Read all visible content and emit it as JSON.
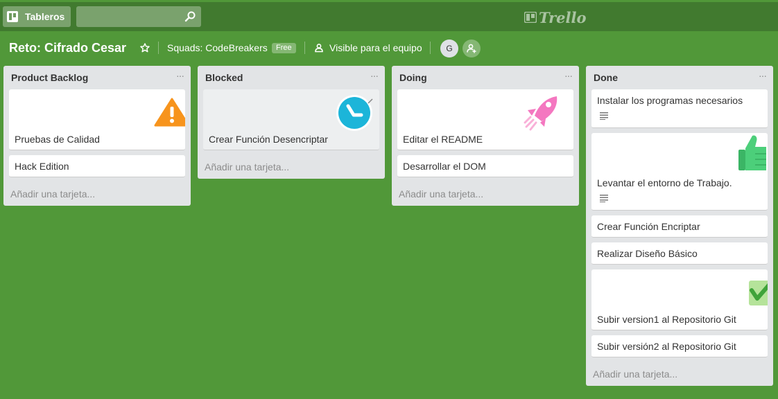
{
  "header": {
    "boards_label": "Tableros",
    "search_placeholder": "",
    "logo_text": "Trello"
  },
  "board": {
    "title": "Reto: Cifrado Cesar",
    "team": "Squads: CodeBreakers",
    "plan_badge": "Free",
    "visibility": "Visible para el equipo",
    "member_initial": "G"
  },
  "lists": [
    {
      "title": "Product Backlog",
      "cards": [
        {
          "text": "Pruebas de Calidad",
          "sticker": "warning-sticker"
        },
        {
          "text": "Hack Edition"
        }
      ],
      "add_label": "Añadir una tarjeta..."
    },
    {
      "title": "Blocked",
      "cards": [
        {
          "text": "Crear Función Desencriptar",
          "sticker": "clock-sticker"
        }
      ],
      "add_label": "Añadir una tarjeta..."
    },
    {
      "title": "Doing",
      "cards": [
        {
          "text": "Editar el README",
          "sticker": "rocket-sticker"
        },
        {
          "text": "Desarrollar el DOM"
        }
      ],
      "add_label": "Añadir una tarjeta..."
    },
    {
      "title": "Done",
      "cards": [
        {
          "text": "Instalar los programas necesarios",
          "has_description": true
        },
        {
          "text": "Levantar el entorno de Trabajo.",
          "sticker": "thumbs-up-sticker",
          "has_description": true
        },
        {
          "text": "Crear Función Encriptar"
        },
        {
          "text": "Realizar Diseño Básico"
        },
        {
          "text": "Subir version1 al Repositorio Git",
          "sticker": "check-sticker"
        },
        {
          "text": "Subir versión2 al Repositorio Git"
        }
      ],
      "add_label": "Añadir una tarjeta..."
    }
  ],
  "colors": {
    "board_background": "#519839",
    "header_background": "#417a2f",
    "list_background": "#e2e4e6"
  }
}
